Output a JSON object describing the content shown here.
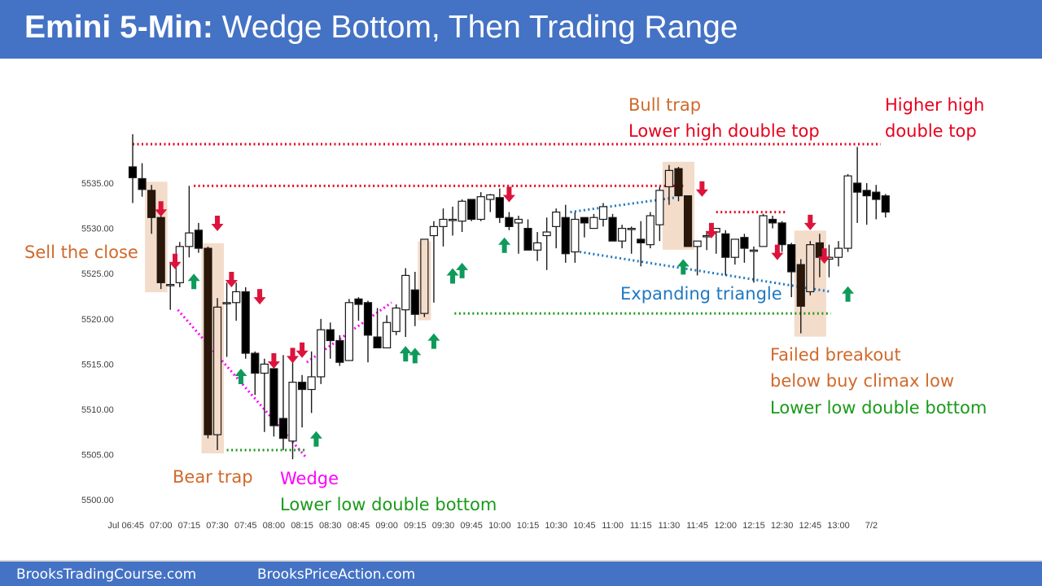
{
  "header": {
    "title_bold": "Emini 5-Min:",
    "title_rest": " Wedge Bottom, Then Trading Range"
  },
  "footer": {
    "left_link": "BrooksTradingCourse.com",
    "right_link": "BrooksPriceAction.com"
  },
  "colors": {
    "header_bg": "#4472c4",
    "bull_body": "#ffffff",
    "bear_body": "#000000",
    "highlight": "#f4dccb",
    "red": "#e8001c",
    "orange": "#d0692a",
    "green": "#1a9a1a",
    "magenta": "#ff00ff",
    "blue": "#1f78c1",
    "arrow_up": "#0e9a5a",
    "arrow_down": "#dc143c"
  },
  "chart_data": {
    "type": "candlestick",
    "title": "Emini 5-Min: Wedge Bottom, Then Trading Range",
    "ylim": [
      5498,
      5542
    ],
    "y_ticks": [
      "5535.00",
      "5530.00",
      "5525.00",
      "5520.00",
      "5515.00",
      "5510.00",
      "5505.00",
      "5500.00"
    ],
    "y_tick_values": [
      5535,
      5530,
      5525,
      5520,
      5515,
      5510,
      5505,
      5500
    ],
    "x_ticks": [
      "Jul 06:45",
      "07:00",
      "07:15",
      "07:30",
      "07:45",
      "08:00",
      "08:15",
      "08:30",
      "08:45",
      "09:00",
      "09:15",
      "09:30",
      "09:45",
      "10:00",
      "10:15",
      "10:30",
      "10:45",
      "11:00",
      "11:15",
      "11:30",
      "11:45",
      "12:00",
      "12:15",
      "12:30",
      "12:45",
      "13:00",
      "7/2"
    ],
    "x_tick_bars": [
      0,
      3,
      6,
      9,
      12,
      15,
      18,
      21,
      24,
      27,
      30,
      33,
      36,
      39,
      42,
      45,
      48,
      51,
      54,
      57,
      60,
      63,
      66,
      69,
      72,
      75,
      78.5
    ],
    "candles": [
      {
        "o": 5536.8,
        "h": 5540.4,
        "l": 5532.8,
        "c": 5535.6
      },
      {
        "o": 5535.5,
        "h": 5537.2,
        "l": 5533.5,
        "c": 5534.3
      },
      {
        "o": 5534.2,
        "h": 5534.8,
        "l": 5529.4,
        "c": 5531.2
      },
      {
        "o": 5531.2,
        "h": 5532.0,
        "l": 5523.3,
        "c": 5524.0
      },
      {
        "o": 5523.8,
        "h": 5526.2,
        "l": 5521.0,
        "c": 5523.8
      },
      {
        "o": 5524.0,
        "h": 5528.5,
        "l": 5523.5,
        "c": 5528.0
      },
      {
        "o": 5528.0,
        "h": 5534.7,
        "l": 5526.8,
        "c": 5529.5
      },
      {
        "o": 5529.8,
        "h": 5530.6,
        "l": 5527.3,
        "c": 5527.8
      },
      {
        "o": 5527.8,
        "h": 5528.0,
        "l": 5506.8,
        "c": 5507.2
      },
      {
        "o": 5507.2,
        "h": 5522.3,
        "l": 5505.5,
        "c": 5521.3
      },
      {
        "o": 5521.8,
        "h": 5524.0,
        "l": 5515.8,
        "c": 5521.8
      },
      {
        "o": 5521.8,
        "h": 5524.0,
        "l": 5519.8,
        "c": 5523.0
      },
      {
        "o": 5523.0,
        "h": 5523.5,
        "l": 5515.6,
        "c": 5516.2
      },
      {
        "o": 5516.2,
        "h": 5516.4,
        "l": 5511.6,
        "c": 5514.0
      },
      {
        "o": 5514.0,
        "h": 5515.6,
        "l": 5507.5,
        "c": 5515.0
      },
      {
        "o": 5514.5,
        "h": 5514.5,
        "l": 5507.0,
        "c": 5508.2
      },
      {
        "o": 5509.0,
        "h": 5516.0,
        "l": 5505.5,
        "c": 5506.8
      },
      {
        "o": 5506.5,
        "h": 5515.7,
        "l": 5504.5,
        "c": 5513.0
      },
      {
        "o": 5513.0,
        "h": 5513.8,
        "l": 5508.0,
        "c": 5512.2
      },
      {
        "o": 5512.2,
        "h": 5516.4,
        "l": 5509.6,
        "c": 5513.6
      },
      {
        "o": 5513.6,
        "h": 5520.0,
        "l": 5512.8,
        "c": 5518.8
      },
      {
        "o": 5518.8,
        "h": 5519.6,
        "l": 5515.6,
        "c": 5517.6
      },
      {
        "o": 5517.6,
        "h": 5518.2,
        "l": 5514.8,
        "c": 5515.2
      },
      {
        "o": 5515.4,
        "h": 5522.2,
        "l": 5515.4,
        "c": 5521.8
      },
      {
        "o": 5522.2,
        "h": 5522.4,
        "l": 5519.8,
        "c": 5521.6
      },
      {
        "o": 5521.8,
        "h": 5522.0,
        "l": 5515.2,
        "c": 5518.2
      },
      {
        "o": 5518.0,
        "h": 5521.2,
        "l": 5516.8,
        "c": 5516.8
      },
      {
        "o": 5516.8,
        "h": 5520.4,
        "l": 5516.8,
        "c": 5519.6
      },
      {
        "o": 5518.6,
        "h": 5521.6,
        "l": 5518.2,
        "c": 5521.2
      },
      {
        "o": 5521.0,
        "h": 5525.6,
        "l": 5518.0,
        "c": 5524.8
      },
      {
        "o": 5523.2,
        "h": 5525.2,
        "l": 5519.2,
        "c": 5520.5
      },
      {
        "o": 5520.6,
        "h": 5528.2,
        "l": 5520.2,
        "c": 5528.8
      },
      {
        "o": 5529.2,
        "h": 5530.8,
        "l": 5521.8,
        "c": 5530.2
      },
      {
        "o": 5530.2,
        "h": 5532.2,
        "l": 5528.0,
        "c": 5531.0
      },
      {
        "o": 5531.0,
        "h": 5532.4,
        "l": 5529.2,
        "c": 5531.0
      },
      {
        "o": 5530.8,
        "h": 5533.2,
        "l": 5529.6,
        "c": 5533.0
      },
      {
        "o": 5533.2,
        "h": 5533.2,
        "l": 5530.8,
        "c": 5531.0
      },
      {
        "o": 5531.0,
        "h": 5534.0,
        "l": 5530.8,
        "c": 5533.5
      },
      {
        "o": 5533.2,
        "h": 5533.8,
        "l": 5531.8,
        "c": 5533.7
      },
      {
        "o": 5533.4,
        "h": 5534.4,
        "l": 5530.6,
        "c": 5531.2
      },
      {
        "o": 5531.2,
        "h": 5531.8,
        "l": 5529.8,
        "c": 5530.2
      },
      {
        "o": 5530.6,
        "h": 5531.4,
        "l": 5527.2,
        "c": 5531.0
      },
      {
        "o": 5530.0,
        "h": 5531.0,
        "l": 5527.6,
        "c": 5527.6
      },
      {
        "o": 5527.6,
        "h": 5529.6,
        "l": 5526.4,
        "c": 5528.4
      },
      {
        "o": 5529.2,
        "h": 5531.2,
        "l": 5525.4,
        "c": 5529.6
      },
      {
        "o": 5530.2,
        "h": 5532.2,
        "l": 5527.8,
        "c": 5531.8
      },
      {
        "o": 5531.2,
        "h": 5532.6,
        "l": 5526.2,
        "c": 5527.2
      },
      {
        "o": 5527.4,
        "h": 5531.8,
        "l": 5526.2,
        "c": 5531.0
      },
      {
        "o": 5531.2,
        "h": 5531.2,
        "l": 5529.0,
        "c": 5530.6
      },
      {
        "o": 5530.0,
        "h": 5531.6,
        "l": 5530.0,
        "c": 5531.2
      },
      {
        "o": 5531.0,
        "h": 5532.8,
        "l": 5530.2,
        "c": 5532.4
      },
      {
        "o": 5531.2,
        "h": 5531.6,
        "l": 5528.6,
        "c": 5528.6
      },
      {
        "o": 5528.6,
        "h": 5530.4,
        "l": 5527.8,
        "c": 5530.0
      },
      {
        "o": 5530.0,
        "h": 5530.2,
        "l": 5527.2,
        "c": 5530.0
      },
      {
        "o": 5528.8,
        "h": 5530.8,
        "l": 5525.8,
        "c": 5528.4
      },
      {
        "o": 5528.2,
        "h": 5531.8,
        "l": 5527.8,
        "c": 5531.4
      },
      {
        "o": 5530.4,
        "h": 5534.6,
        "l": 5528.6,
        "c": 5534.2
      },
      {
        "o": 5534.6,
        "h": 5537.0,
        "l": 5532.6,
        "c": 5536.4
      },
      {
        "o": 5536.6,
        "h": 5536.8,
        "l": 5533.0,
        "c": 5533.6
      },
      {
        "o": 5533.6,
        "h": 5533.6,
        "l": 5528.0,
        "c": 5528.0
      },
      {
        "o": 5528.0,
        "h": 5528.4,
        "l": 5524.8,
        "c": 5528.6
      },
      {
        "o": 5529.2,
        "h": 5529.6,
        "l": 5527.6,
        "c": 5529.2
      },
      {
        "o": 5529.6,
        "h": 5530.0,
        "l": 5527.2,
        "c": 5530.0
      },
      {
        "o": 5529.4,
        "h": 5529.8,
        "l": 5524.8,
        "c": 5526.8
      },
      {
        "o": 5526.8,
        "h": 5528.8,
        "l": 5526.0,
        "c": 5528.8
      },
      {
        "o": 5529.0,
        "h": 5529.4,
        "l": 5526.2,
        "c": 5527.8
      },
      {
        "o": 5527.6,
        "h": 5528.0,
        "l": 5524.0,
        "c": 5527.6
      },
      {
        "o": 5528.0,
        "h": 5531.6,
        "l": 5528.0,
        "c": 5531.4
      },
      {
        "o": 5531.0,
        "h": 5531.4,
        "l": 5530.0,
        "c": 5530.6
      },
      {
        "o": 5530.6,
        "h": 5530.8,
        "l": 5527.4,
        "c": 5528.2
      },
      {
        "o": 5528.2,
        "h": 5528.4,
        "l": 5522.4,
        "c": 5525.2
      },
      {
        "o": 5526.0,
        "h": 5526.6,
        "l": 5518.4,
        "c": 5521.4
      },
      {
        "o": 5523.0,
        "h": 5528.6,
        "l": 5522.6,
        "c": 5528.2
      },
      {
        "o": 5528.4,
        "h": 5529.4,
        "l": 5524.6,
        "c": 5526.8
      },
      {
        "o": 5526.6,
        "h": 5528.2,
        "l": 5524.6,
        "c": 5526.8
      },
      {
        "o": 5526.8,
        "h": 5528.6,
        "l": 5525.8,
        "c": 5527.8
      },
      {
        "o": 5527.8,
        "h": 5536.0,
        "l": 5527.4,
        "c": 5535.8
      },
      {
        "o": 5535.0,
        "h": 5539.0,
        "l": 5530.6,
        "c": 5534.0
      },
      {
        "o": 5534.2,
        "h": 5535.0,
        "l": 5530.4,
        "c": 5533.6
      },
      {
        "o": 5534.0,
        "h": 5534.8,
        "l": 5531.0,
        "c": 5533.2
      },
      {
        "o": 5533.6,
        "h": 5533.8,
        "l": 5531.2,
        "c": 5531.8
      }
    ],
    "highlight_ranges": [
      [
        2,
        3
      ],
      [
        8,
        9
      ],
      [
        31,
        31
      ],
      [
        57,
        59
      ],
      [
        71,
        73
      ]
    ],
    "down_arrows": [
      {
        "bar": 3,
        "price": 5533.0
      },
      {
        "bar": 4.5,
        "price": 5527.2
      },
      {
        "bar": 9,
        "price": 5531.4
      },
      {
        "bar": 10.5,
        "price": 5525.2
      },
      {
        "bar": 13.5,
        "price": 5523.3
      },
      {
        "bar": 15,
        "price": 5516.2
      },
      {
        "bar": 17,
        "price": 5516.8
      },
      {
        "bar": 18,
        "price": 5517.4
      },
      {
        "bar": 40,
        "price": 5534.6
      },
      {
        "bar": 60.5,
        "price": 5535.2
      },
      {
        "bar": 61.5,
        "price": 5530.6
      },
      {
        "bar": 68.5,
        "price": 5528.2
      },
      {
        "bar": 72,
        "price": 5531.5
      },
      {
        "bar": 73.5,
        "price": 5527.8
      }
    ],
    "up_arrows": [
      {
        "bar": 6.5,
        "price": 5525.0
      },
      {
        "bar": 11.5,
        "price": 5514.5
      },
      {
        "bar": 19.5,
        "price": 5507.6
      },
      {
        "bar": 29,
        "price": 5517.0
      },
      {
        "bar": 30,
        "price": 5516.8
      },
      {
        "bar": 32,
        "price": 5518.4
      },
      {
        "bar": 34,
        "price": 5525.6
      },
      {
        "bar": 35,
        "price": 5526.2
      },
      {
        "bar": 39.5,
        "price": 5529.0
      },
      {
        "bar": 58.5,
        "price": 5526.6
      },
      {
        "bar": 76,
        "price": 5523.6
      }
    ],
    "lines": [
      {
        "name": "high-line-red-top",
        "color": "#e8001c",
        "from": [
          0,
          5539.3
        ],
        "to": [
          79.5,
          5539.3
        ]
      },
      {
        "name": "high-line-red-second",
        "color": "#e8001c",
        "from": [
          6.5,
          5534.7
        ],
        "to": [
          58.5,
          5534.7
        ]
      },
      {
        "name": "high-line-red-third",
        "color": "#e8001c",
        "from": [
          62,
          5531.8
        ],
        "to": [
          69.5,
          5531.8
        ]
      },
      {
        "name": "wedge-line-lower",
        "color": "#ff00ff",
        "from": [
          4.8,
          5521.0
        ],
        "to": [
          18.5,
          5504.6
        ]
      },
      {
        "name": "wedge-line-upper",
        "color": "#ff00ff",
        "from": [
          18.5,
          5515.2
        ],
        "to": [
          27.5,
          5521.8
        ]
      },
      {
        "name": "double-bottom-line-left",
        "color": "#1a9a1a",
        "from": [
          10,
          5505.5
        ],
        "to": [
          18.3,
          5505.5
        ]
      },
      {
        "name": "double-bottom-line-right",
        "color": "#1a9a1a",
        "from": [
          34.2,
          5520.6
        ],
        "to": [
          74.2,
          5520.6
        ]
      },
      {
        "name": "triangle-line-upper",
        "color": "#1f78c1",
        "from": [
          46.5,
          5531.8
        ],
        "to": [
          57.6,
          5533.4
        ]
      },
      {
        "name": "triangle-line-lower",
        "color": "#1f78c1",
        "from": [
          47.5,
          5527.4
        ],
        "to": [
          74.2,
          5523.0
        ]
      }
    ],
    "annotations": [
      {
        "name": "sell-the-close-label",
        "lines": [
          "Sell the close"
        ],
        "color": "#d0692a"
      },
      {
        "name": "bear-trap-label",
        "lines": [
          "Bear trap"
        ],
        "color": "#d0692a"
      },
      {
        "name": "wedge-label",
        "lines": [
          "Wedge"
        ],
        "color": "#ff00ff"
      },
      {
        "name": "lower-low-double-bottom-left-label",
        "lines": [
          "Lower low double bottom"
        ],
        "color": "#1a9a1a"
      },
      {
        "name": "bull-trap-label",
        "lines": [
          "Bull trap"
        ],
        "color": "#d0692a"
      },
      {
        "name": "lower-high-double-top-label",
        "lines": [
          "Lower high double top"
        ],
        "color": "#e8001c"
      },
      {
        "name": "higher-high-double-top-label",
        "lines": [
          "Higher high",
          "double top"
        ],
        "color": "#e8001c"
      },
      {
        "name": "expanding-triangle-label",
        "lines": [
          "Expanding triangle"
        ],
        "color": "#1f78c1"
      },
      {
        "name": "failed-breakout-label",
        "lines": [
          "Failed breakout",
          "below buy climax low"
        ],
        "color": "#d0692a"
      },
      {
        "name": "lower-low-double-bottom-right-label",
        "lines": [
          "Lower low double bottom"
        ],
        "color": "#1a9a1a"
      }
    ]
  }
}
